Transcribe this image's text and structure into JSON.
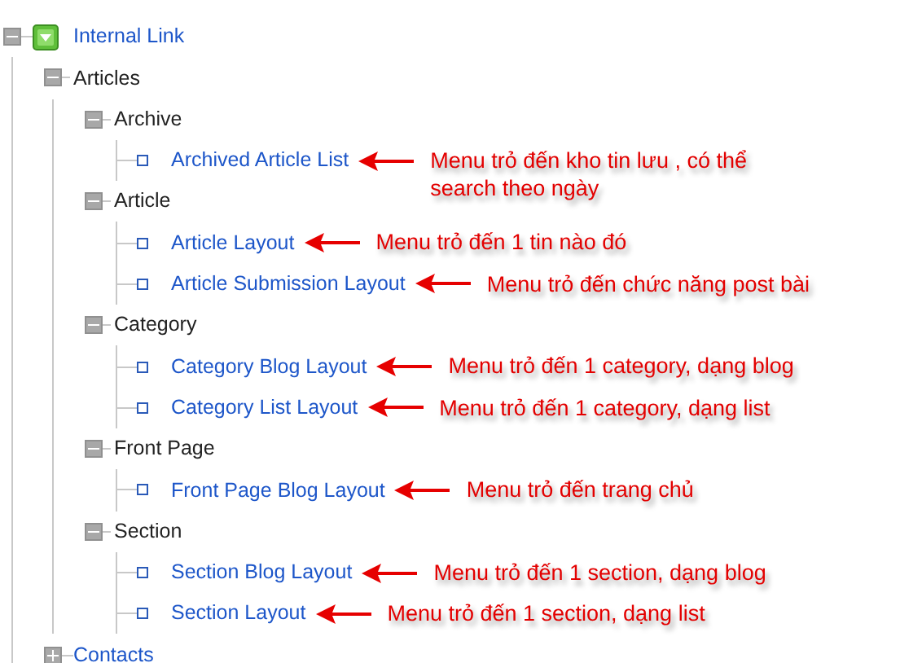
{
  "tree": [
    {
      "label": "Internal Link",
      "kind": "module",
      "expanded": true,
      "children": [
        {
          "label": "Articles",
          "kind": "group",
          "expanded": true,
          "children": [
            {
              "label": "Archive",
              "kind": "group",
              "expanded": true,
              "children": [
                {
                  "label": "Archived Article List",
                  "kind": "item",
                  "note": "Menu  trỏ đến kho tin lưu , có thể search theo ngày"
                }
              ]
            },
            {
              "label": "Article",
              "kind": "group",
              "expanded": true,
              "children": [
                {
                  "label": "Article Layout",
                  "kind": "item",
                  "note": "Menu  trỏ đến 1 tin nào đó"
                },
                {
                  "label": "Article Submission Layout",
                  "kind": "item",
                  "note": "Menu  trỏ đến chức năng post bài"
                }
              ]
            },
            {
              "label": "Category",
              "kind": "group",
              "expanded": true,
              "children": [
                {
                  "label": "Category Blog Layout",
                  "kind": "item",
                  "note": "Menu trỏ đến 1 category, dạng blog"
                },
                {
                  "label": "Category List Layout",
                  "kind": "item",
                  "note": "Menu trỏ đến 1 category, dạng list"
                }
              ]
            },
            {
              "label": "Front Page",
              "kind": "group",
              "expanded": true,
              "children": [
                {
                  "label": "Front Page Blog Layout",
                  "kind": "item",
                  "note": "Menu trỏ đến trang chủ"
                }
              ]
            },
            {
              "label": "Section",
              "kind": "group",
              "expanded": true,
              "children": [
                {
                  "label": "Section Blog Layout",
                  "kind": "item",
                  "note": "Menu trỏ đến 1 section, dạng blog"
                },
                {
                  "label": "Section Layout",
                  "kind": "item",
                  "note": "Menu trỏ đến 1 section, dạng list"
                }
              ]
            }
          ]
        },
        {
          "label": "Contacts",
          "kind": "section",
          "expanded": false
        }
      ]
    }
  ]
}
